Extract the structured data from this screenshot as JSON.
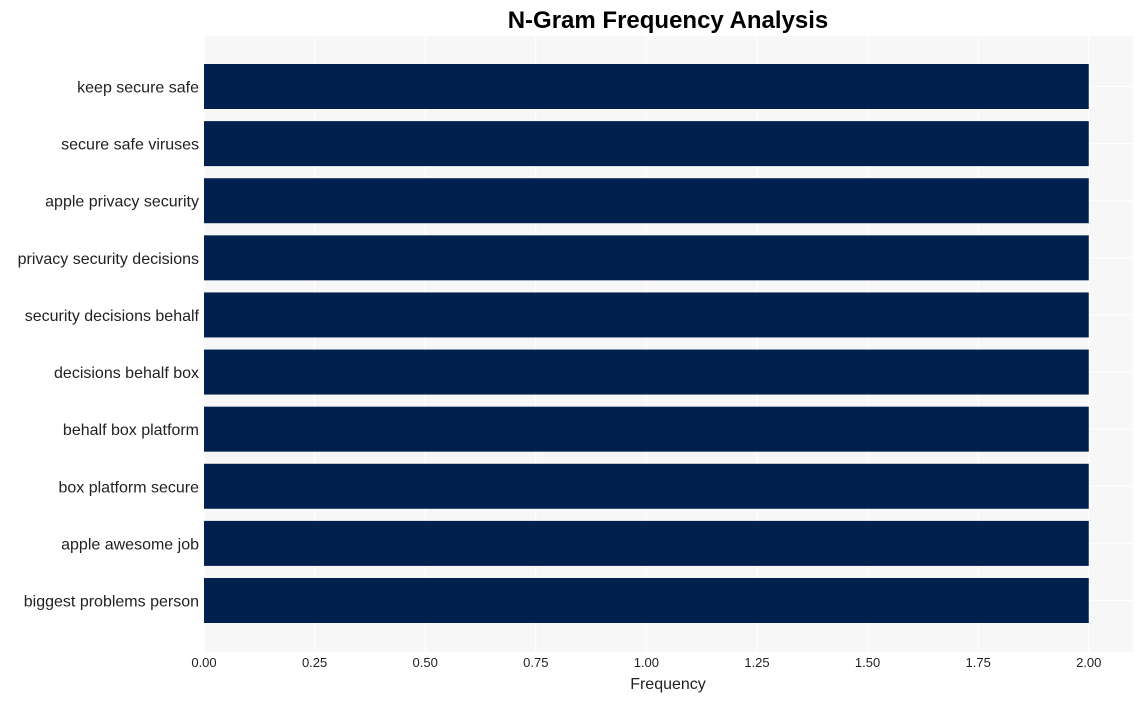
{
  "chart_data": {
    "type": "bar",
    "orientation": "horizontal",
    "title": "N-Gram Frequency Analysis",
    "xlabel": "Frequency",
    "ylabel": "",
    "categories": [
      "keep secure safe",
      "secure safe viruses",
      "apple privacy security",
      "privacy security decisions",
      "security decisions behalf",
      "decisions behalf box",
      "behalf box platform",
      "box platform secure",
      "apple awesome job",
      "biggest problems person"
    ],
    "values": [
      2,
      2,
      2,
      2,
      2,
      2,
      2,
      2,
      2,
      2
    ],
    "xlim": [
      0,
      2.1
    ],
    "xticks": [
      0,
      0.25,
      0.5,
      0.75,
      1.0,
      1.25,
      1.5,
      1.75,
      2.0
    ],
    "xtick_labels": [
      "0.00",
      "0.25",
      "0.50",
      "0.75",
      "1.00",
      "1.25",
      "1.50",
      "1.75",
      "2.00"
    ],
    "grid": true,
    "legend": "none",
    "colors": {
      "bar": "#00214d",
      "plot_background": "#f7f7f7",
      "grid": "#ffffff"
    }
  }
}
